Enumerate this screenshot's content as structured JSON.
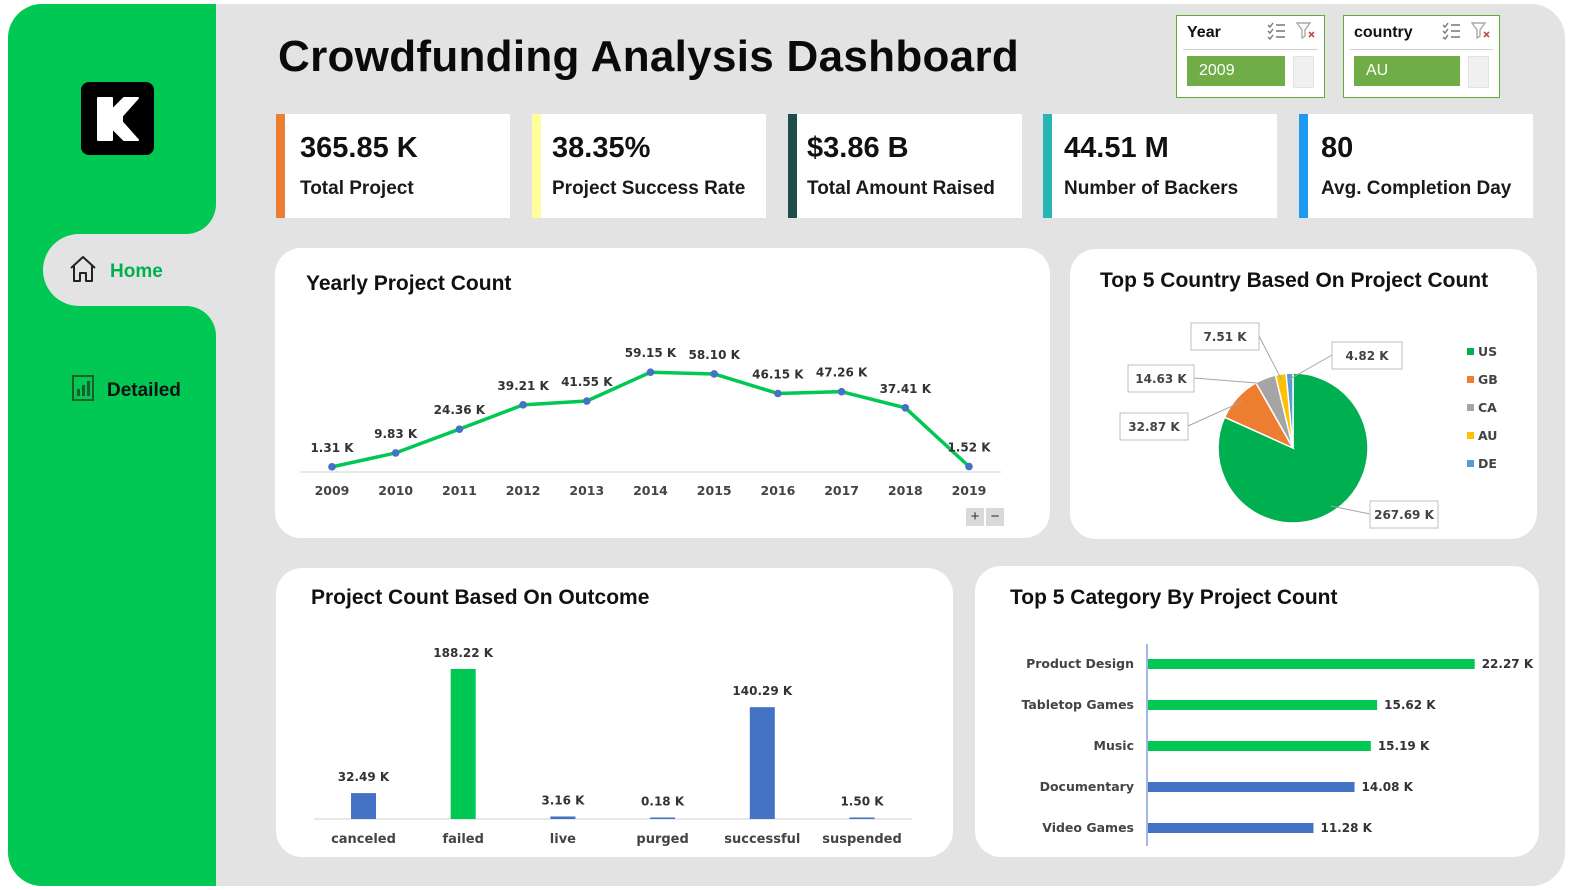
{
  "dashboard": {
    "title": "Crowdfunding Analysis Dashboard",
    "brand_color": "#00c853"
  },
  "nav": {
    "home_label": "Home",
    "detailed_label": "Detailed"
  },
  "slicers": {
    "year": {
      "label": "Year",
      "selected": "2009"
    },
    "country": {
      "label": "country",
      "selected": "AU"
    }
  },
  "kpis": [
    {
      "value": "365.85 K",
      "label": "Total Project",
      "color": "#ed7d31"
    },
    {
      "value": "38.35%",
      "label": "Project Success Rate",
      "color": "#ffff99"
    },
    {
      "value": "$3.86 B",
      "label": "Total Amount Raised",
      "color": "#1e4d4a"
    },
    {
      "value": "44.51 M",
      "label": "Number of Backers",
      "color": "#2ab5b5"
    },
    {
      "value": "80",
      "label": "Avg. Completion Day",
      "color": "#1e9bf0"
    }
  ],
  "chart_data": [
    {
      "type": "line",
      "title": "Yearly Project Count",
      "categories": [
        "2009",
        "2010",
        "2011",
        "2012",
        "2013",
        "2014",
        "2015",
        "2016",
        "2017",
        "2018",
        "2019"
      ],
      "values": [
        1.31,
        9.83,
        24.36,
        39.21,
        41.55,
        59.15,
        58.1,
        46.15,
        47.26,
        37.41,
        1.52
      ],
      "data_labels": [
        "1.31 K",
        "9.83 K",
        "24.36 K",
        "39.21 K",
        "41.55 K",
        "59.15 K",
        "58.10 K",
        "46.15 K",
        "47.26 K",
        "37.41 K",
        "1.52 K"
      ],
      "line_color": "#00c853",
      "marker_color": "#4472c4"
    },
    {
      "type": "pie",
      "title": "Top 5 Country Based On Project Count",
      "categories": [
        "US",
        "GB",
        "CA",
        "AU",
        "DE"
      ],
      "values": [
        267.69,
        32.87,
        14.63,
        7.51,
        4.82
      ],
      "data_labels": [
        "267.69 K",
        "32.87 K",
        "14.63 K",
        "7.51 K",
        "4.82 K"
      ],
      "colors": [
        "#00b050",
        "#ed7d31",
        "#a5a5a5",
        "#ffc000",
        "#5b9bd5"
      ],
      "legend": "right"
    },
    {
      "type": "bar",
      "title": "Project Count Based On Outcome",
      "categories": [
        "canceled",
        "failed",
        "live",
        "purged",
        "successful",
        "suspended"
      ],
      "values": [
        32.49,
        188.22,
        3.16,
        0.18,
        140.29,
        1.5
      ],
      "data_labels": [
        "32.49 K",
        "188.22 K",
        "3.16 K",
        "0.18 K",
        "140.29 K",
        "1.50 K"
      ],
      "colors": [
        "#4472c4",
        "#00c853",
        "#4472c4",
        "#4472c4",
        "#4472c4",
        "#4472c4"
      ]
    },
    {
      "type": "bar",
      "orientation": "horizontal",
      "title": "Top 5 Category By Project Count",
      "categories": [
        "Product Design",
        "Tabletop Games",
        "Music",
        "Documentary",
        "Video Games"
      ],
      "values": [
        22.27,
        15.62,
        15.19,
        14.08,
        11.28
      ],
      "data_labels": [
        "22.27 K",
        "15.62 K",
        "15.19 K",
        "14.08 K",
        "11.28 K"
      ],
      "colors": [
        "#00c853",
        "#00c853",
        "#00c853",
        "#4472c4",
        "#4472c4"
      ]
    }
  ]
}
